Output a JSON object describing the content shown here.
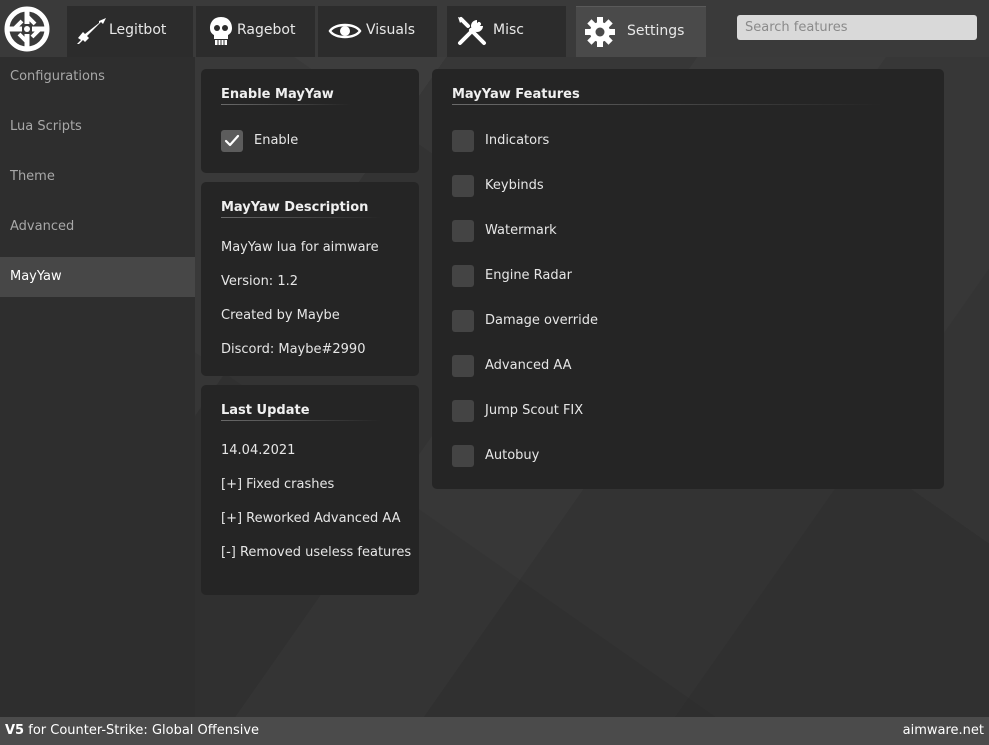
{
  "header": {
    "tabs": [
      {
        "label": "Legitbot",
        "icon": "rifle-icon"
      },
      {
        "label": "Ragebot",
        "icon": "skull-icon"
      },
      {
        "label": "Visuals",
        "icon": "eye-icon"
      },
      {
        "label": "Misc",
        "icon": "tools-icon"
      },
      {
        "label": "Settings",
        "icon": "gear-icon"
      }
    ],
    "active_tab": "Settings",
    "search_placeholder": "Search features"
  },
  "sidebar": {
    "items": [
      {
        "label": "Configurations"
      },
      {
        "label": "Lua Scripts"
      },
      {
        "label": "Theme"
      },
      {
        "label": "Advanced"
      },
      {
        "label": "MayYaw"
      }
    ],
    "active": "MayYaw"
  },
  "enable_panel": {
    "title": "Enable MayYaw",
    "checkbox_label": "Enable",
    "checked": true
  },
  "description_panel": {
    "title": "MayYaw Description",
    "lines": [
      "MayYaw lua for aimware",
      "Version: 1.2",
      "Created by Maybe",
      "Discord: Maybe#2990"
    ]
  },
  "update_panel": {
    "title": "Last Update",
    "lines": [
      "14.04.2021",
      "[+] Fixed crashes",
      "[+] Reworked Advanced AA",
      "[-] Removed useless features"
    ]
  },
  "features_panel": {
    "title": "MayYaw Features",
    "items": [
      {
        "label": "Indicators",
        "checked": false
      },
      {
        "label": "Keybinds",
        "checked": false
      },
      {
        "label": "Watermark",
        "checked": false
      },
      {
        "label": "Engine Radar",
        "checked": false
      },
      {
        "label": "Damage override",
        "checked": false
      },
      {
        "label": "Advanced AA",
        "checked": false
      },
      {
        "label": "Jump Scout FIX",
        "checked": false
      },
      {
        "label": "Autobuy",
        "checked": false
      }
    ]
  },
  "footer": {
    "version": "V5",
    "game_text": " for Counter-Strike: Global Offensive",
    "site": "aimware.net"
  }
}
